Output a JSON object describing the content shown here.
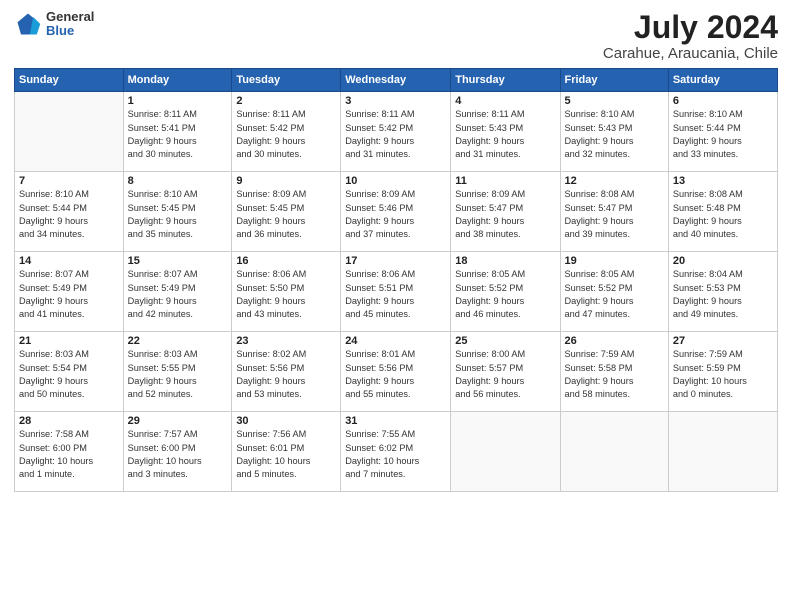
{
  "header": {
    "logo_line1": "General",
    "logo_line2": "Blue",
    "title": "July 2024",
    "subtitle": "Carahue, Araucania, Chile"
  },
  "columns": [
    "Sunday",
    "Monday",
    "Tuesday",
    "Wednesday",
    "Thursday",
    "Friday",
    "Saturday"
  ],
  "weeks": [
    [
      {
        "day": "",
        "info": ""
      },
      {
        "day": "1",
        "info": "Sunrise: 8:11 AM\nSunset: 5:41 PM\nDaylight: 9 hours\nand 30 minutes."
      },
      {
        "day": "2",
        "info": "Sunrise: 8:11 AM\nSunset: 5:42 PM\nDaylight: 9 hours\nand 30 minutes."
      },
      {
        "day": "3",
        "info": "Sunrise: 8:11 AM\nSunset: 5:42 PM\nDaylight: 9 hours\nand 31 minutes."
      },
      {
        "day": "4",
        "info": "Sunrise: 8:11 AM\nSunset: 5:43 PM\nDaylight: 9 hours\nand 31 minutes."
      },
      {
        "day": "5",
        "info": "Sunrise: 8:10 AM\nSunset: 5:43 PM\nDaylight: 9 hours\nand 32 minutes."
      },
      {
        "day": "6",
        "info": "Sunrise: 8:10 AM\nSunset: 5:44 PM\nDaylight: 9 hours\nand 33 minutes."
      }
    ],
    [
      {
        "day": "7",
        "info": "Sunrise: 8:10 AM\nSunset: 5:44 PM\nDaylight: 9 hours\nand 34 minutes."
      },
      {
        "day": "8",
        "info": "Sunrise: 8:10 AM\nSunset: 5:45 PM\nDaylight: 9 hours\nand 35 minutes."
      },
      {
        "day": "9",
        "info": "Sunrise: 8:09 AM\nSunset: 5:45 PM\nDaylight: 9 hours\nand 36 minutes."
      },
      {
        "day": "10",
        "info": "Sunrise: 8:09 AM\nSunset: 5:46 PM\nDaylight: 9 hours\nand 37 minutes."
      },
      {
        "day": "11",
        "info": "Sunrise: 8:09 AM\nSunset: 5:47 PM\nDaylight: 9 hours\nand 38 minutes."
      },
      {
        "day": "12",
        "info": "Sunrise: 8:08 AM\nSunset: 5:47 PM\nDaylight: 9 hours\nand 39 minutes."
      },
      {
        "day": "13",
        "info": "Sunrise: 8:08 AM\nSunset: 5:48 PM\nDaylight: 9 hours\nand 40 minutes."
      }
    ],
    [
      {
        "day": "14",
        "info": "Sunrise: 8:07 AM\nSunset: 5:49 PM\nDaylight: 9 hours\nand 41 minutes."
      },
      {
        "day": "15",
        "info": "Sunrise: 8:07 AM\nSunset: 5:49 PM\nDaylight: 9 hours\nand 42 minutes."
      },
      {
        "day": "16",
        "info": "Sunrise: 8:06 AM\nSunset: 5:50 PM\nDaylight: 9 hours\nand 43 minutes."
      },
      {
        "day": "17",
        "info": "Sunrise: 8:06 AM\nSunset: 5:51 PM\nDaylight: 9 hours\nand 45 minutes."
      },
      {
        "day": "18",
        "info": "Sunrise: 8:05 AM\nSunset: 5:52 PM\nDaylight: 9 hours\nand 46 minutes."
      },
      {
        "day": "19",
        "info": "Sunrise: 8:05 AM\nSunset: 5:52 PM\nDaylight: 9 hours\nand 47 minutes."
      },
      {
        "day": "20",
        "info": "Sunrise: 8:04 AM\nSunset: 5:53 PM\nDaylight: 9 hours\nand 49 minutes."
      }
    ],
    [
      {
        "day": "21",
        "info": "Sunrise: 8:03 AM\nSunset: 5:54 PM\nDaylight: 9 hours\nand 50 minutes."
      },
      {
        "day": "22",
        "info": "Sunrise: 8:03 AM\nSunset: 5:55 PM\nDaylight: 9 hours\nand 52 minutes."
      },
      {
        "day": "23",
        "info": "Sunrise: 8:02 AM\nSunset: 5:56 PM\nDaylight: 9 hours\nand 53 minutes."
      },
      {
        "day": "24",
        "info": "Sunrise: 8:01 AM\nSunset: 5:56 PM\nDaylight: 9 hours\nand 55 minutes."
      },
      {
        "day": "25",
        "info": "Sunrise: 8:00 AM\nSunset: 5:57 PM\nDaylight: 9 hours\nand 56 minutes."
      },
      {
        "day": "26",
        "info": "Sunrise: 7:59 AM\nSunset: 5:58 PM\nDaylight: 9 hours\nand 58 minutes."
      },
      {
        "day": "27",
        "info": "Sunrise: 7:59 AM\nSunset: 5:59 PM\nDaylight: 10 hours\nand 0 minutes."
      }
    ],
    [
      {
        "day": "28",
        "info": "Sunrise: 7:58 AM\nSunset: 6:00 PM\nDaylight: 10 hours\nand 1 minute."
      },
      {
        "day": "29",
        "info": "Sunrise: 7:57 AM\nSunset: 6:00 PM\nDaylight: 10 hours\nand 3 minutes."
      },
      {
        "day": "30",
        "info": "Sunrise: 7:56 AM\nSunset: 6:01 PM\nDaylight: 10 hours\nand 5 minutes."
      },
      {
        "day": "31",
        "info": "Sunrise: 7:55 AM\nSunset: 6:02 PM\nDaylight: 10 hours\nand 7 minutes."
      },
      {
        "day": "",
        "info": ""
      },
      {
        "day": "",
        "info": ""
      },
      {
        "day": "",
        "info": ""
      }
    ]
  ]
}
